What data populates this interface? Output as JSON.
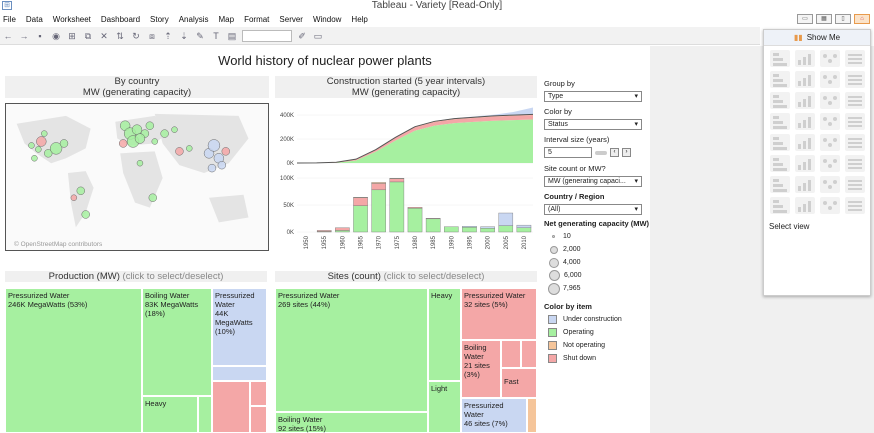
{
  "window": {
    "title": "Tableau - Variety [Read-Only]"
  },
  "menu": [
    "File",
    "Data",
    "Worksheet",
    "Dashboard",
    "Story",
    "Analysis",
    "Map",
    "Format",
    "Server",
    "Window",
    "Help"
  ],
  "dashboard": {
    "title": "World history of nuclear power plants",
    "map_panel": {
      "title_line1": "By country",
      "title_line2": "MW (generating capacity)",
      "attribution": "© OpenStreetMap contributors"
    },
    "construction_panel": {
      "title_line1": "Construction started (5 year intervals)",
      "title_line2": "MW (generating capacity)"
    },
    "production_panel": {
      "title": "Production (MW)",
      "hint": "(click to select/deselect)"
    },
    "sites_panel": {
      "title": "Sites (count)",
      "hint": "(click to select/deselect)"
    }
  },
  "treemap_production": [
    {
      "label": "Pressurized Water",
      "detail": "246K MegaWatts (53%)"
    },
    {
      "label": "Boiling Water",
      "detail": "83K MegaWatts (18%)"
    },
    {
      "label": "Pressurized Water",
      "detail": "44K MegaWatts (10%)"
    },
    {
      "label": "Heavy",
      "detail": ""
    }
  ],
  "treemap_sites": [
    {
      "label": "Pressurized Water",
      "detail": "269 sites (44%)"
    },
    {
      "label": "Heavy",
      "detail": ""
    },
    {
      "label": "Pressurized Water",
      "detail": "32 sites (5%)"
    },
    {
      "label": "Boiling Water",
      "detail": "21 sites (3%)"
    },
    {
      "label": "Fast",
      "detail": ""
    },
    {
      "label": "Light",
      "detail": ""
    },
    {
      "label": "Boiling Water",
      "detail": "92 sites (15%)"
    },
    {
      "label": "Pressurized Water",
      "detail": "46 sites (7%)"
    }
  ],
  "controls": {
    "group_by_label": "Group by",
    "group_by_value": "Type",
    "color_by_label": "Color by",
    "color_by_value": "Status",
    "interval_label": "Interval size (years)",
    "interval_value": "5",
    "count_label": "Site count or MW?",
    "count_value": "MW (generating capaci...",
    "region_label": "Country / Region",
    "region_value": "(All)"
  },
  "size_legend": {
    "title": "Net generating capacity (MW)",
    "items": [
      "10",
      "2,000",
      "4,000",
      "6,000",
      "7,965"
    ]
  },
  "color_legend": {
    "title": "Color by item",
    "items": [
      {
        "label": "Under construction",
        "color": "#c9d7f2"
      },
      {
        "label": "Operating",
        "color": "#a6f0a0"
      },
      {
        "label": "Not operating",
        "color": "#f5c59a"
      },
      {
        "label": "Shut down",
        "color": "#f4a7a7"
      }
    ]
  },
  "showme": {
    "header": "Show Me",
    "footer": "Select view"
  },
  "chart_data": [
    {
      "type": "area",
      "title": "Construction started (5 year intervals)",
      "x": [
        1950,
        1955,
        1960,
        1965,
        1970,
        1975,
        1980,
        1985,
        1990,
        1995,
        2000,
        2005,
        2010
      ],
      "yticks": [
        "400K",
        "200K",
        "0K"
      ],
      "ylim": [
        0,
        450000
      ],
      "series": [
        {
          "name": "Operating",
          "values": [
            0,
            0,
            2000,
            20000,
            90000,
            180000,
            260000,
            300000,
            320000,
            330000,
            340000,
            345000,
            350000
          ]
        },
        {
          "name": "Shut down",
          "values": [
            0,
            1000,
            4000,
            10000,
            15000,
            22000,
            28000,
            30000,
            32000,
            33000,
            34000,
            35000,
            36000
          ]
        },
        {
          "name": "Not operating",
          "values": [
            0,
            0,
            0,
            1000,
            2000,
            3000,
            4000,
            5000,
            5000,
            5000,
            5000,
            5000,
            5000
          ]
        },
        {
          "name": "Under construction",
          "values": [
            0,
            0,
            0,
            0,
            0,
            1000,
            2000,
            3000,
            4000,
            6000,
            9000,
            25000,
            55000
          ]
        }
      ]
    },
    {
      "type": "bar",
      "categories": [
        "1950",
        "1955",
        "1960",
        "1965",
        "1970",
        "1975",
        "1980",
        "1985",
        "1990",
        "1995",
        "2000",
        "2005",
        "2010"
      ],
      "yticks": [
        "100K",
        "50K",
        "0K"
      ],
      "ylim": [
        0,
        110000
      ],
      "series": [
        {
          "name": "Operating",
          "values": [
            0,
            1000,
            3000,
            50000,
            80000,
            95000,
            45000,
            25000,
            10000,
            9000,
            7000,
            12000,
            8000
          ]
        },
        {
          "name": "Shut down",
          "values": [
            0,
            2000,
            5000,
            15000,
            12000,
            6000,
            2000,
            1000,
            0,
            0,
            0,
            0,
            0
          ]
        },
        {
          "name": "Not operating",
          "values": [
            0,
            0,
            0,
            1000,
            2000,
            1000,
            0,
            0,
            0,
            0,
            0,
            0,
            0
          ]
        },
        {
          "name": "Under construction",
          "values": [
            0,
            0,
            0,
            0,
            0,
            0,
            0,
            0,
            0,
            2000,
            3000,
            24000,
            5000
          ]
        }
      ]
    }
  ]
}
